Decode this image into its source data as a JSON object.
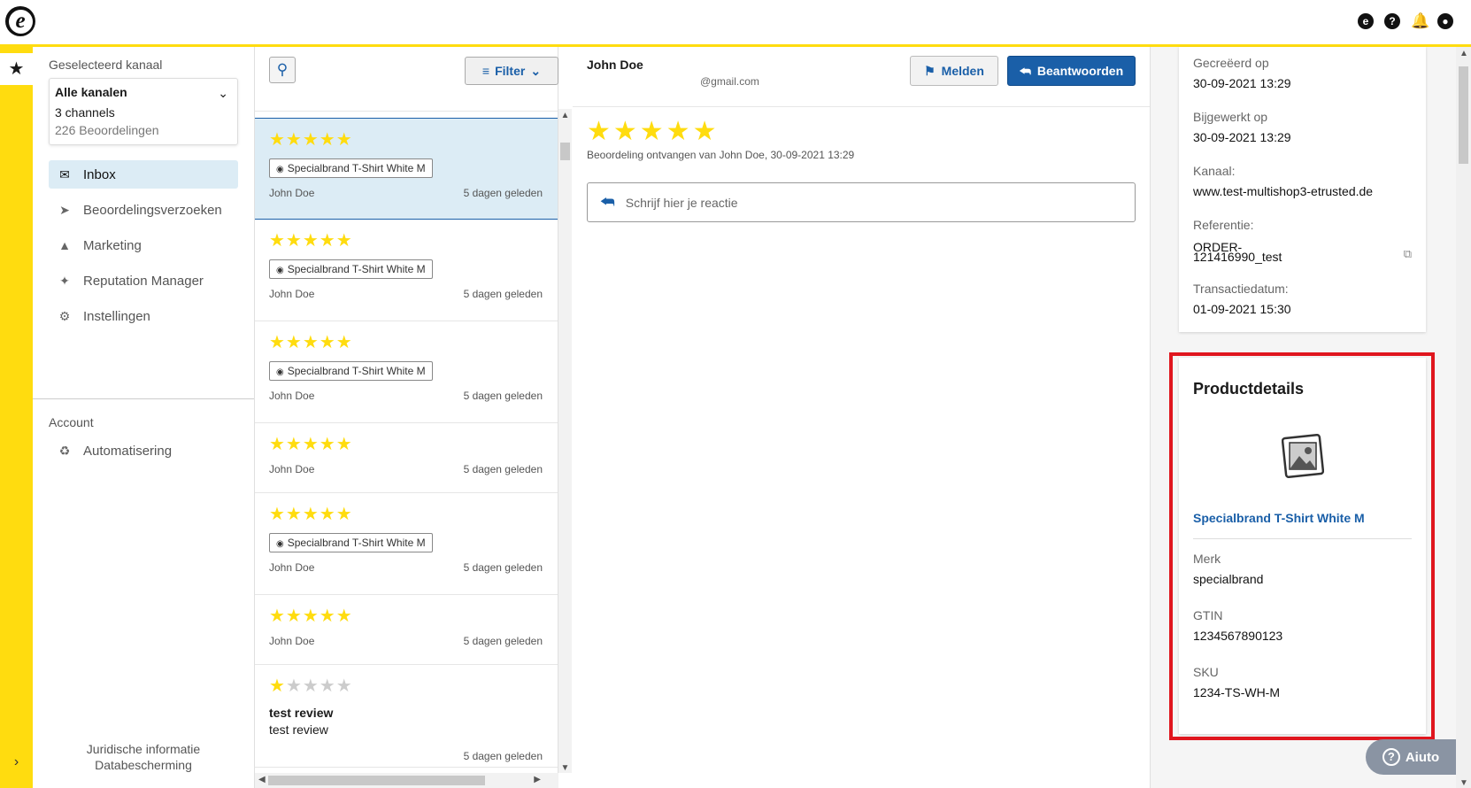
{
  "app": {
    "logo_letter": "e"
  },
  "topbar": {
    "icons": [
      "etrusted-icon",
      "help-icon",
      "bell-icon",
      "account-icon"
    ]
  },
  "sidebar": {
    "channel_label": "Geselecteerd kanaal",
    "channel": {
      "title": "Alle kanalen",
      "count": "3 channels",
      "reviews": "226 Beoordelingen"
    },
    "items": [
      {
        "label": "Inbox",
        "icon": "inbox-icon"
      },
      {
        "label": "Beoordelingsverzoeken",
        "icon": "send-icon"
      },
      {
        "label": "Marketing",
        "icon": "megaphone-icon"
      },
      {
        "label": "Reputation Manager",
        "icon": "sparkle-icon"
      },
      {
        "label": "Instellingen",
        "icon": "gear-icon"
      }
    ],
    "account_label": "Account",
    "account_items": [
      {
        "label": "Automatisering",
        "icon": "automation-icon"
      }
    ],
    "legal": [
      "Juridische informatie",
      "Databescherming"
    ]
  },
  "list": {
    "filter_label": "Filter",
    "reviews": [
      {
        "rating": 5,
        "product": "Specialbrand T-Shirt White M",
        "author": "John Doe",
        "time": "5 dagen geleden",
        "selected": true
      },
      {
        "rating": 5,
        "product": "Specialbrand T-Shirt White M",
        "author": "John Doe",
        "time": "5 dagen geleden"
      },
      {
        "rating": 5,
        "product": "Specialbrand T-Shirt White M",
        "author": "John Doe",
        "time": "5 dagen geleden"
      },
      {
        "rating": 5,
        "author": "John Doe",
        "time": "5 dagen geleden"
      },
      {
        "rating": 5,
        "product": "Specialbrand T-Shirt White M",
        "author": "John Doe",
        "time": "5 dagen geleden"
      },
      {
        "rating": 5,
        "author": "John Doe",
        "time": "5 dagen geleden"
      },
      {
        "rating": 1,
        "title": "test review",
        "body": "test review",
        "time": "5 dagen geleden"
      }
    ]
  },
  "detail": {
    "name": "John Doe",
    "email": "@gmail.com",
    "report_label": "Melden",
    "reply_label": "Beantwoorden",
    "rating": 5,
    "subline": "Beoordeling ontvangen van John Doe, 30-09-2021 13:29",
    "reply_placeholder": "Schrijf hier je reactie"
  },
  "info": {
    "created_label": "Gecreëerd op",
    "created": "30-09-2021 13:29",
    "updated_label": "Bijgewerkt op",
    "updated": "30-09-2021 13:29",
    "channel_label": "Kanaal:",
    "channel": "www.test-multishop3-etrusted.de",
    "reference_label": "Referentie:",
    "reference": "ORDER-121416990_test",
    "transaction_label": "Transactiedatum:",
    "transaction": "01-09-2021 15:30"
  },
  "product": {
    "title": "Productdetails",
    "name": "Specialbrand T-Shirt White M",
    "brand_label": "Merk",
    "brand": "specialbrand",
    "gtin_label": "GTIN",
    "gtin": "1234567890123",
    "sku_label": "SKU",
    "sku": "1234-TS-WH-M"
  },
  "help": {
    "label": "Aiuto"
  },
  "colors": {
    "accent": "#ffdc0f",
    "brand_blue": "#1a5fa8",
    "highlight": "#e0161e",
    "selected_bg": "#dcecf5"
  }
}
